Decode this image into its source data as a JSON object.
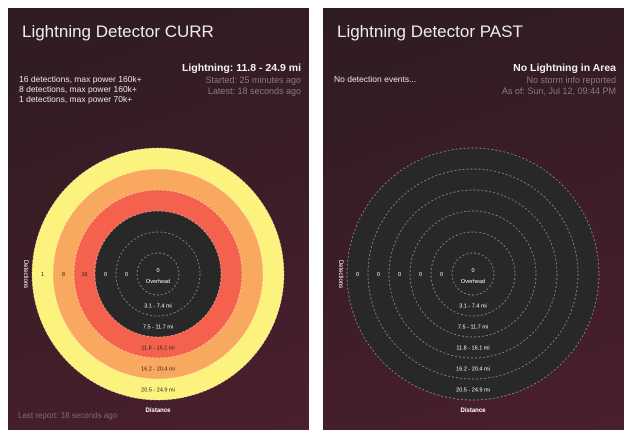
{
  "cards": [
    {
      "title": "Lightning Detector CURR",
      "status_head": "Lightning: 11.8 - 24.9 mi",
      "status_lines": [
        "Started: 25 minutes ago",
        "Latest: 18 seconds ago"
      ],
      "info_lines": [
        "16 detections, max power 160k+",
        "8 detections, max power 160k+",
        "1 detections, max power 70k+"
      ],
      "footer": "Last report: 18 seconds ago"
    },
    {
      "title": "Lightning Detector PAST",
      "status_head": "No Lightning in Area",
      "status_lines": [
        "No storm info reported",
        "As of: Sun, Jul 12, 09:44 PM"
      ],
      "info_lines": [
        "No detection events..."
      ],
      "footer": ""
    }
  ],
  "chart_data": [
    {
      "type": "radial",
      "xlabel": "Distance",
      "ylabel": "Detections",
      "center_label": "Overhead",
      "center_count": 0,
      "rings": [
        "3.1 - 7.4 mi",
        "7.5 - 11.7 mi",
        "11.8 - 16.1 mi",
        "16.2 - 20.4 mi",
        "20.5 - 24.9 mi"
      ],
      "counts": [
        0,
        0,
        16,
        8,
        1
      ],
      "ring_colors": [
        "#282828",
        "#282828",
        "#f4624e",
        "#f9a85f",
        "#fcf37e"
      ]
    },
    {
      "type": "radial",
      "xlabel": "Distance",
      "ylabel": "Detections",
      "center_label": "Overhead",
      "center_count": 0,
      "rings": [
        "3.1 - 7.4 mi",
        "7.5 - 11.7 mi",
        "11.8 - 16.1 mi",
        "16.2 - 20.4 mi",
        "20.5 - 24.9 mi"
      ],
      "counts": [
        0,
        0,
        0,
        0,
        0
      ],
      "ring_colors": [
        "#282828",
        "#282828",
        "#282828",
        "#282828",
        "#282828"
      ]
    }
  ]
}
